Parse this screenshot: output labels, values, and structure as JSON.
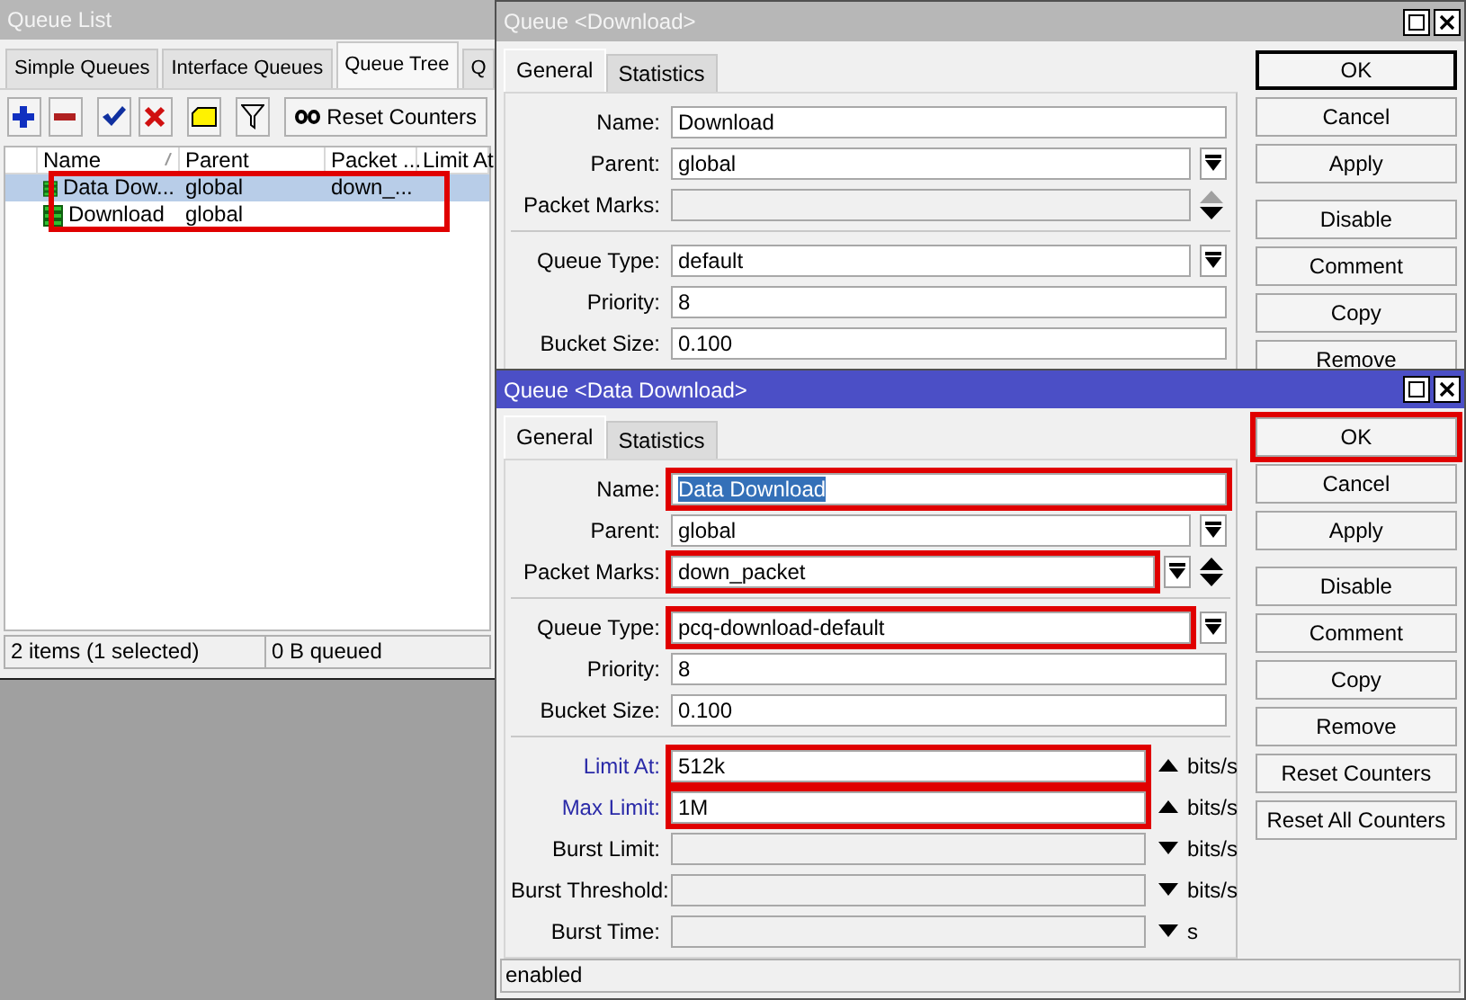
{
  "queue_list": {
    "title": "Queue List",
    "active": false,
    "tabs": [
      {
        "label": "Simple Queues",
        "selected": false
      },
      {
        "label": "Interface Queues",
        "selected": false
      },
      {
        "label": "Queue Tree",
        "selected": true
      },
      {
        "label": "Q",
        "selected": false
      }
    ],
    "toolbar": [
      {
        "kind": "add"
      },
      {
        "kind": "remove"
      },
      {
        "kind": "enable"
      },
      {
        "kind": "disable"
      },
      {
        "kind": "comment"
      },
      {
        "kind": "filter"
      },
      {
        "kind": "reset",
        "label": "Reset Counters"
      }
    ],
    "table": {
      "columns": [
        "Name",
        "Parent",
        "Packet ...",
        "Limit At"
      ],
      "highlighted": true,
      "rows": [
        {
          "cells": [
            "Data Dow...",
            "global",
            "down_..."
          ],
          "selected": true
        },
        {
          "cells": [
            "Download",
            "global"
          ],
          "selected": false
        }
      ]
    },
    "status": [
      "2 items (1 selected)",
      "0 B queued"
    ]
  },
  "dialogs": [
    {
      "title": "Queue <Download>",
      "active": false,
      "tabs": [
        {
          "label": "General",
          "selected": true
        },
        {
          "label": "Statistics",
          "selected": false
        }
      ],
      "sections": [
        [
          {
            "label": "Name:",
            "kind": "text",
            "value": "Download"
          },
          {
            "label": "Parent:",
            "kind": "select",
            "value": "global"
          },
          {
            "label": "Packet Marks:",
            "kind": "marks",
            "disabled": true
          }
        ],
        [
          {
            "label": "Queue Type:",
            "kind": "select",
            "value": "default"
          },
          {
            "label": "Priority:",
            "kind": "text",
            "value": "8"
          },
          {
            "label": "Bucket Size:",
            "kind": "text",
            "value": "0.100"
          }
        ]
      ],
      "button_groups": [
        [
          {
            "label": "OK",
            "default": true,
            "highlighted": false
          },
          {
            "label": "Cancel"
          },
          {
            "label": "Apply"
          }
        ],
        [
          {
            "label": "Disable"
          },
          {
            "label": "Comment"
          },
          {
            "label": "Copy"
          },
          {
            "label": "Remove"
          }
        ]
      ]
    },
    {
      "title": "Queue <Data Download>",
      "active": true,
      "tabs": [
        {
          "label": "General",
          "selected": true
        },
        {
          "label": "Statistics",
          "selected": false
        }
      ],
      "sections": [
        [
          {
            "label": "Name:",
            "kind": "text",
            "value": "Data Download",
            "value_selected": true,
            "highlighted": true
          },
          {
            "label": "Parent:",
            "kind": "select",
            "value": "global"
          },
          {
            "label": "Packet Marks:",
            "kind": "marks",
            "value": "down_packet",
            "highlighted": true
          }
        ],
        [
          {
            "label": "Queue Type:",
            "kind": "select",
            "value": "pcq-download-default",
            "highlighted": true
          },
          {
            "label": "Priority:",
            "kind": "text",
            "value": "8"
          },
          {
            "label": "Bucket Size:",
            "kind": "text",
            "value": "0.100"
          }
        ],
        [
          {
            "label": "Limit At:",
            "kind": "rate",
            "value": "512k",
            "accent": true,
            "expanded": true,
            "highlighted": true,
            "unit": "bits/s"
          },
          {
            "label": "Max Limit:",
            "kind": "rate",
            "value": "1M",
            "accent": true,
            "expanded": true,
            "highlighted": true,
            "unit": "bits/s"
          },
          {
            "label": "Burst Limit:",
            "kind": "rate",
            "disabled": true,
            "expanded": false,
            "unit": "bits/s"
          },
          {
            "label": "Burst Threshold:",
            "kind": "rate",
            "disabled": true,
            "expanded": false,
            "unit": "bits/s"
          },
          {
            "label": "Burst Time:",
            "kind": "rate",
            "disabled": true,
            "expanded": false,
            "unit": "s"
          }
        ]
      ],
      "button_groups": [
        [
          {
            "label": "OK",
            "default": false,
            "highlighted": true
          },
          {
            "label": "Cancel"
          },
          {
            "label": "Apply"
          }
        ],
        [
          {
            "label": "Disable"
          },
          {
            "label": "Comment"
          },
          {
            "label": "Copy"
          },
          {
            "label": "Remove"
          },
          {
            "label": "Reset Counters"
          },
          {
            "label": "Reset All Counters"
          }
        ]
      ],
      "status": "enabled"
    }
  ]
}
